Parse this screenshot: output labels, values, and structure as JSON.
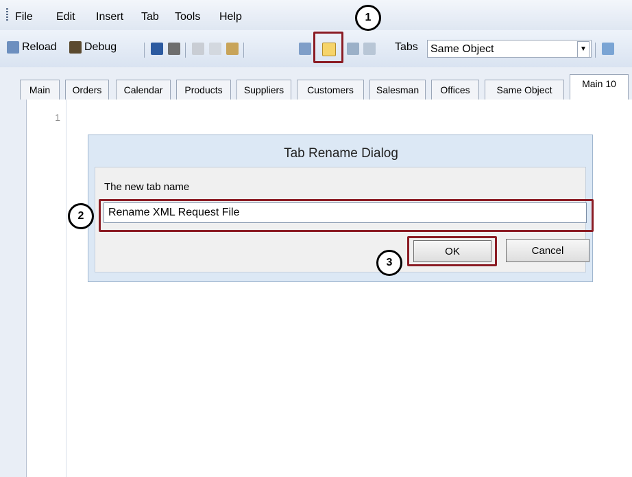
{
  "menu": {
    "items": [
      {
        "label": "File"
      },
      {
        "label": "Edit"
      },
      {
        "label": "Insert"
      },
      {
        "label": "Tab"
      },
      {
        "label": "Tools"
      },
      {
        "label": "Help"
      }
    ]
  },
  "toolbar": {
    "reload_label": "Reload",
    "debug_label": "Debug",
    "tabs_label": "Tabs",
    "tabs_select_value": "Same Object",
    "icons": [
      "reload-icon",
      "debug-icon",
      "save-icon",
      "print-icon",
      "cut-icon",
      "copy-icon",
      "paste-icon",
      "find-icon",
      "rename-tab-icon",
      "prev-tab-icon",
      "next-tab-icon",
      "tree-icon"
    ]
  },
  "tabs": [
    {
      "label": "Main"
    },
    {
      "label": "Orders"
    },
    {
      "label": "Calendar"
    },
    {
      "label": "Products"
    },
    {
      "label": "Suppliers"
    },
    {
      "label": "Customers"
    },
    {
      "label": "Salesman"
    },
    {
      "label": "Offices"
    },
    {
      "label": "Same Object"
    },
    {
      "label": "Main 10",
      "active": true
    }
  ],
  "editor": {
    "line_numbers": [
      "1"
    ]
  },
  "dialog": {
    "title": "Tab Rename Dialog",
    "label": "The new tab name",
    "input_value": "Rename XML Request File",
    "ok_label": "OK",
    "cancel_label": "Cancel"
  },
  "annotations": {
    "step1": "1",
    "step2": "2",
    "step3": "3"
  },
  "colors": {
    "highlight": "#8b1c24",
    "dialog_bg": "#dce8f5"
  }
}
